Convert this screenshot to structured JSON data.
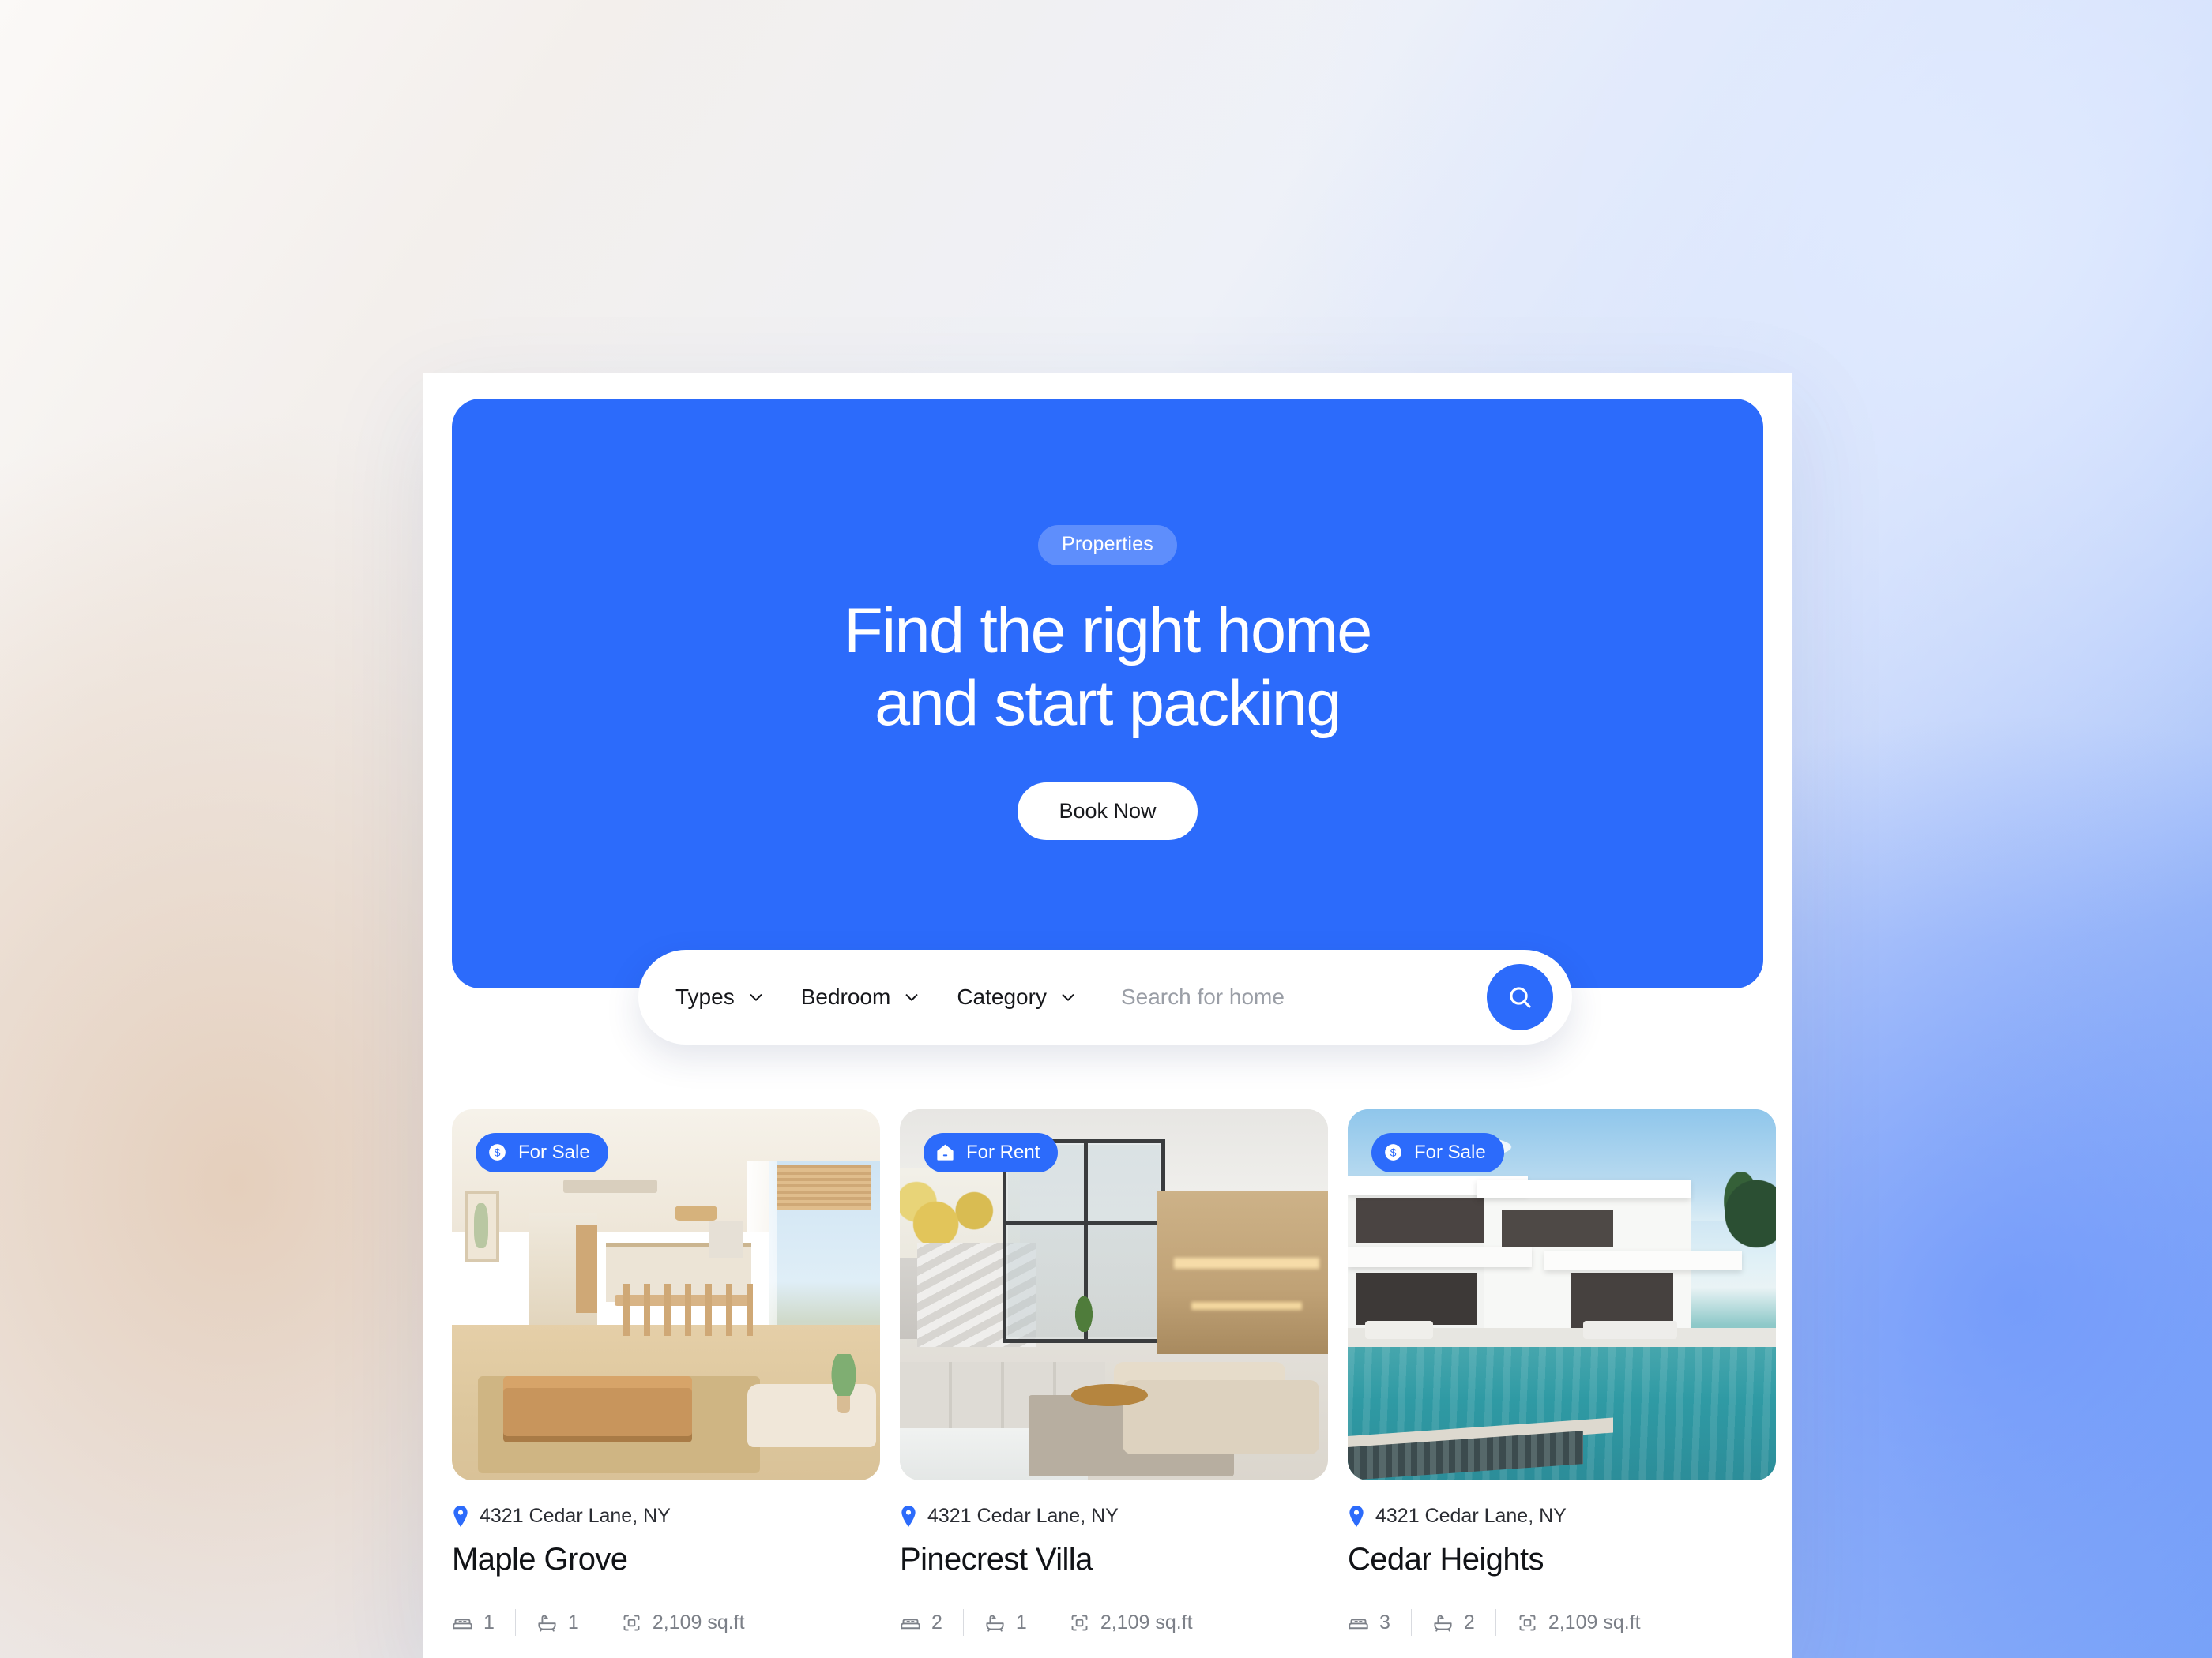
{
  "theme": {
    "accent": "#2c6bfb",
    "pill_bg": "#5e8efc",
    "panel_bg": "#ffffff",
    "text_dark": "#111317",
    "text_muted": "#7c8088"
  },
  "hero": {
    "badge": "Properties",
    "title_line1": "Find the right home",
    "title_line2": "and start packing",
    "cta_label": "Book Now"
  },
  "search": {
    "filters": [
      {
        "label": "Types",
        "icon": "chevron-down-icon"
      },
      {
        "label": "Bedroom",
        "icon": "chevron-down-icon"
      },
      {
        "label": "Category",
        "icon": "chevron-down-icon"
      }
    ],
    "input_value": "",
    "placeholder": "Search for home",
    "button_icon": "search-icon"
  },
  "listings": [
    {
      "badge_label": "For Sale",
      "badge_icon": "dollar-circle-icon",
      "address": "4321 Cedar Lane, NY",
      "name": "Maple Grove",
      "beds": "1",
      "baths": "1",
      "area": "2,109 sq.ft"
    },
    {
      "badge_label": "For Rent",
      "badge_icon": "house-icon",
      "address": "4321 Cedar Lane, NY",
      "name": "Pinecrest Villa",
      "beds": "2",
      "baths": "1",
      "area": "2,109 sq.ft"
    },
    {
      "badge_label": "For Sale",
      "badge_icon": "dollar-circle-icon",
      "address": "4321 Cedar Lane, NY",
      "name": "Cedar Heights",
      "beds": "3",
      "baths": "2",
      "area": "2,109 sq.ft"
    }
  ]
}
